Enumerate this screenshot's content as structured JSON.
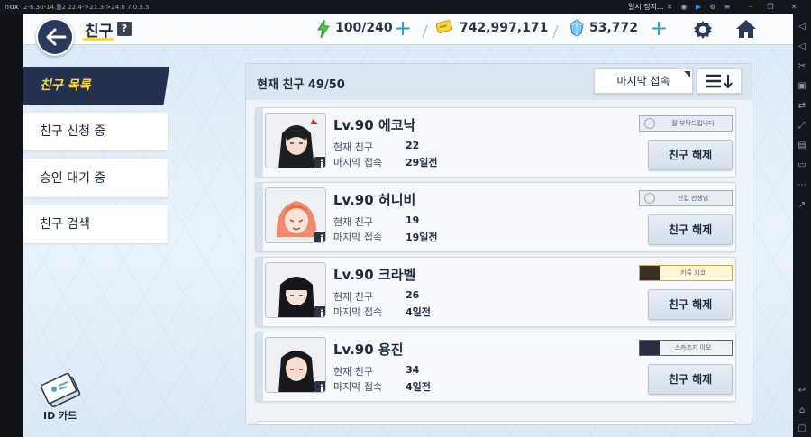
{
  "emulator": {
    "logo": "nox",
    "version_text": "2-6.30-14.폴2 22.4->21.3->24.0 7.0.5.5",
    "pause_text": "일시 정지...",
    "icons": [
      "pin-icon",
      "record-icon",
      "play-icon",
      "settings-icon",
      "menu-icon",
      "minimize-icon",
      "restore-icon",
      "close-icon"
    ],
    "side_icons": [
      "volume-up-icon",
      "volume-down-icon",
      "screenshot-icon",
      "record-icon",
      "swap-icon",
      "fullscreen-icon",
      "toolbox-icon",
      "screen-icon",
      "more-icon",
      "expand-icon",
      "back-icon",
      "home-icon",
      "recent-icon"
    ]
  },
  "header": {
    "title": "친구",
    "help": "?"
  },
  "resources": {
    "stamina": "100/240",
    "gold": "742,997,171",
    "gems": "53,772"
  },
  "menu": {
    "items": [
      {
        "label": "친구 목록",
        "active": true
      },
      {
        "label": "친구 신청 중",
        "active": false
      },
      {
        "label": "승인 대기 중",
        "active": false
      },
      {
        "label": "친구 검색",
        "active": false
      }
    ],
    "id_card_label": "ID 카드"
  },
  "list": {
    "count_label": "현재 친구  49/50",
    "sort_label": "마지막 접속",
    "stat_labels": {
      "current_friends": "현재 친구",
      "last_login": "마지막 접속"
    },
    "unfriend_label": "친구 해제",
    "friends": [
      {
        "name": "Lv.90 에코낙",
        "friends": "22",
        "last_login": "29일전",
        "motto": "잘 부탁드립니다",
        "motto_style": "plain"
      },
      {
        "name": "Lv.90 허니비",
        "friends": "19",
        "last_login": "19일전",
        "motto": "신입 선생님",
        "motto_style": "plain"
      },
      {
        "name": "Lv.90 크라벨",
        "friends": "26",
        "last_login": "4일전",
        "motto": "키류 키코",
        "motto_style": "gold"
      },
      {
        "name": "Lv.90 용진",
        "friends": "34",
        "last_login": "4일전",
        "motto": "스카즈키 이오",
        "motto_style": "dark"
      }
    ]
  },
  "colors": {
    "accent_blue": "#2c9bd8",
    "nav_dark": "#23314e",
    "active_yellow": "#f3d53c"
  }
}
